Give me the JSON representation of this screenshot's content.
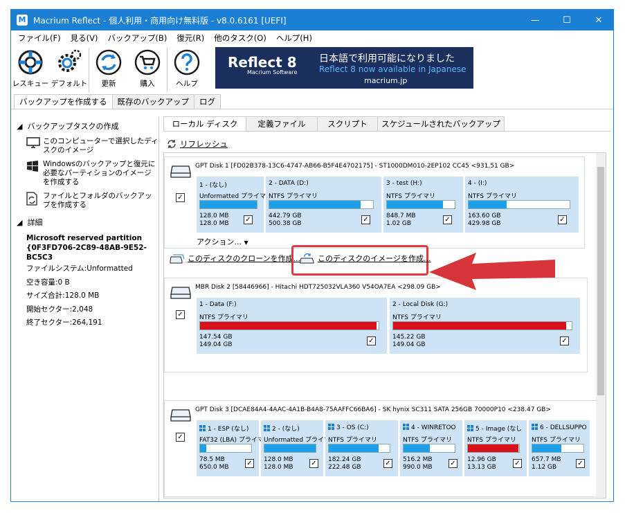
{
  "window": {
    "title": "Macrium Reflect - 個人利用・商用向け無料版 - v8.0.6161  [UEFI]",
    "minimize": "—",
    "maximize": "☐",
    "close": "✕"
  },
  "menu": [
    "ファイル(F)",
    "見る(V)",
    "バックアップ(B)",
    "復元(R)",
    "他のタスク(O)",
    "ヘルプ(H)"
  ],
  "toolbar": {
    "rescue": "レスキュー",
    "default": "デフォルト",
    "update": "更新",
    "buy": "購入",
    "help": "ヘルプ"
  },
  "banner": {
    "logo": "Reflect 8",
    "logo_sub": "Macrium Software",
    "line1": "日本語で利用可能になりました",
    "line2": "Reflect 8 now available in Japanese",
    "line3": "macrium.jp"
  },
  "top_tabs": [
    "バックアップを作成する",
    "既存のバックアップ",
    "ログ"
  ],
  "left": {
    "section1": "バックアップタスクの作成",
    "tasks": [
      "このコンピューターで選択したディスクのイメージ",
      "Windowsのバックアップと復元に必要なパーティションのイメージを作成する",
      "ファイルとフォルダのバックアップを作成する"
    ],
    "section2": "詳細",
    "details": {
      "name": "Microsoft reserved partition",
      "guid": "{0F3FD706-2C89-48AB-9E52-BC5C3",
      "fs": "ファイルシステム:Unformatted",
      "free": "空き容量:0 B",
      "total": "サイズ合計:128.0 MB",
      "start": "開始セクター:2,048",
      "end": "終了セクター:264,191"
    }
  },
  "right_tabs": [
    "ローカル ディスク",
    "定義ファイル",
    "スクリプト",
    "スケジュールされたバックアップ"
  ],
  "refresh": "リフレッシュ",
  "actions": "アクション...",
  "clone_link": "このディスクのクローンを作成...",
  "image_link": "このディスクのイメージを作成...",
  "disks": [
    {
      "header": "GPT Disk 1 [FD02B378-13C6-4747-AB66-B5F4E4702175] - ST1000DM010-2EP102 CC45  <931.51 GB>",
      "partitions": [
        {
          "name": "1 - (なし)",
          "type": "Unformatted プライマリ",
          "used": "128.0 MB",
          "total": "128.0 MB",
          "fill": 1.0,
          "color": "#1ea0e8"
        },
        {
          "name": "2 - DATA (D:)",
          "type": "NTFS プライマリ",
          "used": "442.79 GB",
          "total": "500.38 GB",
          "fill": 0.88,
          "color": "#1ea0e8"
        },
        {
          "name": "3 - test (H:)",
          "type": "NTFS プライマリ",
          "used": "848.7 MB",
          "total": "1.02 GB",
          "fill": 0.83,
          "color": "#1ea0e8"
        },
        {
          "name": "4 - (I:)",
          "type": "NTFS プライマリ",
          "used": "163.60 GB",
          "total": "429.98 GB",
          "fill": 0.38,
          "color": "#1ea0e8"
        }
      ]
    },
    {
      "header": "MBR Disk 2 [58446966] - Hitachi HDT725032VLA360 V54OA7EA  <298.09 GB>",
      "partitions": [
        {
          "name": "1 - Data (F:)",
          "type": "NTFS プライマリ",
          "used": "147.54 GB",
          "total": "149.04 GB",
          "fill": 0.99,
          "color": "#d9101a"
        },
        {
          "name": "2 - Local Disk (G:)",
          "type": "NTFS プライマリ",
          "used": "145.22 GB",
          "total": "149.04 GB",
          "fill": 0.97,
          "color": "#d9101a"
        }
      ]
    },
    {
      "header": "GPT Disk 3 [DCAE84A4-4AAC-4A1B-B4A8-75AAFFC66BA6] - SK hynix SC311 SATA 256GB 70000P10  <238.47 GB>",
      "partitions": [
        {
          "name": "1 - ESP (なし)",
          "type": "FAT32 (LBA) プライマ",
          "used": "78.5 MB",
          "total": "650.0 MB",
          "fill": 0.12,
          "color": "#1ea0e8"
        },
        {
          "name": "2 - (なし)",
          "type": "Unformatted プライマ",
          "used": "128.0 MB",
          "total": "128.0 MB",
          "fill": 1.0,
          "color": "#1ea0e8"
        },
        {
          "name": "3 - OS (C:)",
          "type": "NTFS プライマリ",
          "used": "182.24 GB",
          "total": "222.48 GB",
          "fill": 0.82,
          "color": "#1ea0e8"
        },
        {
          "name": "4 - WINRETOO",
          "type": "NTFS プライマリ",
          "used": "516.2 MB",
          "total": "990.0 MB",
          "fill": 0.52,
          "color": "#1ea0e8"
        },
        {
          "name": "5 - Image (なし",
          "type": "NTFS プライマリ",
          "used": "12.96 GB",
          "total": "13.13 GB",
          "fill": 0.99,
          "color": "#d9101a"
        },
        {
          "name": "6 - DELLSUPPO",
          "type": "NTFS プライマリ",
          "used": "657.7 MB",
          "total": "1.12 GB",
          "fill": 0.57,
          "color": "#1ea0e8"
        }
      ]
    }
  ],
  "checkmark": "✓"
}
